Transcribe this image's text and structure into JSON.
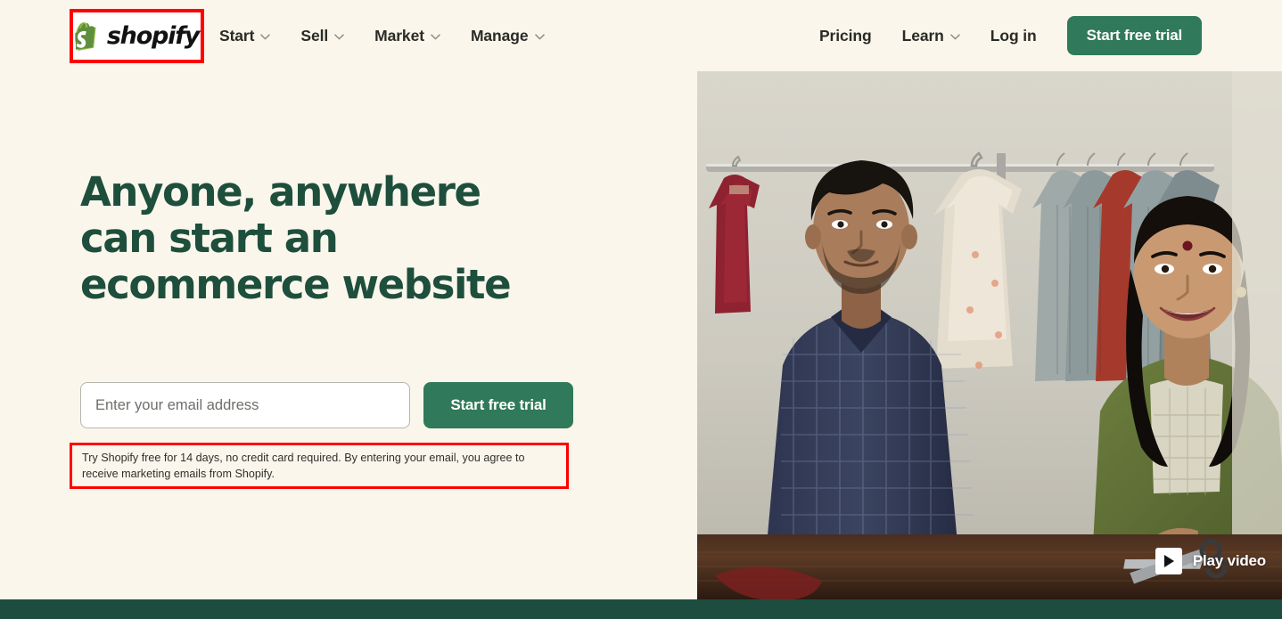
{
  "brand": {
    "name": "shopify",
    "logo_icon": "shopify-bag-icon",
    "accent_green": "#30795A",
    "dark_green": "#1E4E3C",
    "footer_green": "#1D4D3E",
    "page_background": "#FAF6EC",
    "annotation_color": "#FF0000"
  },
  "nav": {
    "left_items": [
      {
        "label": "Start",
        "has_dropdown": true,
        "icon": "chevron-down-icon"
      },
      {
        "label": "Sell",
        "has_dropdown": true,
        "icon": "chevron-down-icon"
      },
      {
        "label": "Market",
        "has_dropdown": true,
        "icon": "chevron-down-icon"
      },
      {
        "label": "Manage",
        "has_dropdown": true,
        "icon": "chevron-down-icon"
      }
    ],
    "right_items": [
      {
        "label": "Pricing",
        "has_dropdown": false
      },
      {
        "label": "Learn",
        "has_dropdown": true,
        "icon": "chevron-down-icon"
      },
      {
        "label": "Log in",
        "has_dropdown": false
      }
    ],
    "cta_label": "Start free trial"
  },
  "hero": {
    "title": "Anyone, anywhere can start an ecommerce website",
    "email_placeholder": "Enter your email address",
    "email_value": "",
    "cta_label": "Start free trial",
    "disclaimer": "Try Shopify free for 14 days, no credit card required. By entering your email, you agree to receive marketing emails from Shopify."
  },
  "media": {
    "play_label": "Play video",
    "play_icon": "play-triangle-icon",
    "alt": "Two shop owners standing behind a counter in a clothing store with a rack of garments behind them"
  }
}
